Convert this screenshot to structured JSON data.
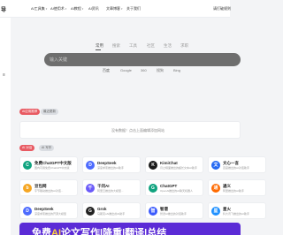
{
  "header": {
    "logo": "导",
    "nav": [
      {
        "label": "AI工具集",
        "caret": "▾"
      },
      {
        "label": "AI使用术",
        "caret": "▾"
      },
      {
        "label": "AI教程",
        "caret": "▾"
      },
      {
        "label": "AI资讯",
        "caret": ""
      },
      {
        "label": "文章博客",
        "caret": "▾"
      },
      {
        "label": "关于我们",
        "caret": ""
      }
    ],
    "right_link": "请打破规则"
  },
  "sidebar": {
    "icon": "≡"
  },
  "search": {
    "tabs": [
      "常用",
      "搜索",
      "工具",
      "社区",
      "生活",
      "求职"
    ],
    "placeholder": "输入关键",
    "engines": [
      "百度",
      "Google",
      "360",
      "搜狗",
      "Bing"
    ]
  },
  "section1": {
    "pills": [
      "AI应用推荐",
      "最近更新"
    ],
    "notice": "没有数据！点击上面编辑添加网站"
  },
  "section2": {
    "pills": [
      "AI 对话",
      "AI 写作"
    ],
    "tools": [
      {
        "icon": "C",
        "color": "#10a37f",
        "title": "免费ChatGPT中文版",
        "desc": "国内可用免费ChatGPT中文版"
      },
      {
        "icon": "D",
        "color": "#4d6bfe",
        "title": "DeepSeek",
        "desc": "深度求索推出的AI助手"
      },
      {
        "icon": "K",
        "color": "#1a1a1a",
        "title": "KimiChat",
        "desc": "月之暗面推出的超长文本AI助手"
      },
      {
        "icon": "文",
        "color": "#2468f2",
        "title": "文心一言",
        "desc": "百度推出的AI对话助手"
      },
      {
        "icon": "b",
        "color": "#f5a623",
        "title": "豆包网",
        "desc": "字节跳动推出的AI对话..."
      },
      {
        "icon": "千",
        "color": "#6a5af9",
        "title": "千问AI",
        "desc": "阿里云推出的大模型..."
      },
      {
        "icon": "G",
        "color": "#10a37f",
        "title": "ChatGPT",
        "desc": "OpenAI推出的AI聊天机器人"
      },
      {
        "icon": "通",
        "color": "#ff6a00",
        "title": "通义",
        "desc": "阿里推出的AI助手"
      },
      {
        "icon": "D",
        "color": "#4d6bfe",
        "title": "DeepSeek",
        "desc": "深度求索推出的开源大模型"
      },
      {
        "icon": "G",
        "color": "#222222",
        "title": "Grok",
        "desc": "马斯克xAI推出的AI助手"
      },
      {
        "icon": "智",
        "color": "#3b5bfd",
        "title": "智谱",
        "desc": "智谱AI推出的对话助手"
      },
      {
        "icon": "星",
        "color": "#1e90ff",
        "title": "星火",
        "desc": "科大讯飞推出的AI助手"
      }
    ]
  },
  "banner": {
    "prefix": "免费",
    "highlight": "AI",
    "text": "论文写作|降重|翻译|总结"
  }
}
